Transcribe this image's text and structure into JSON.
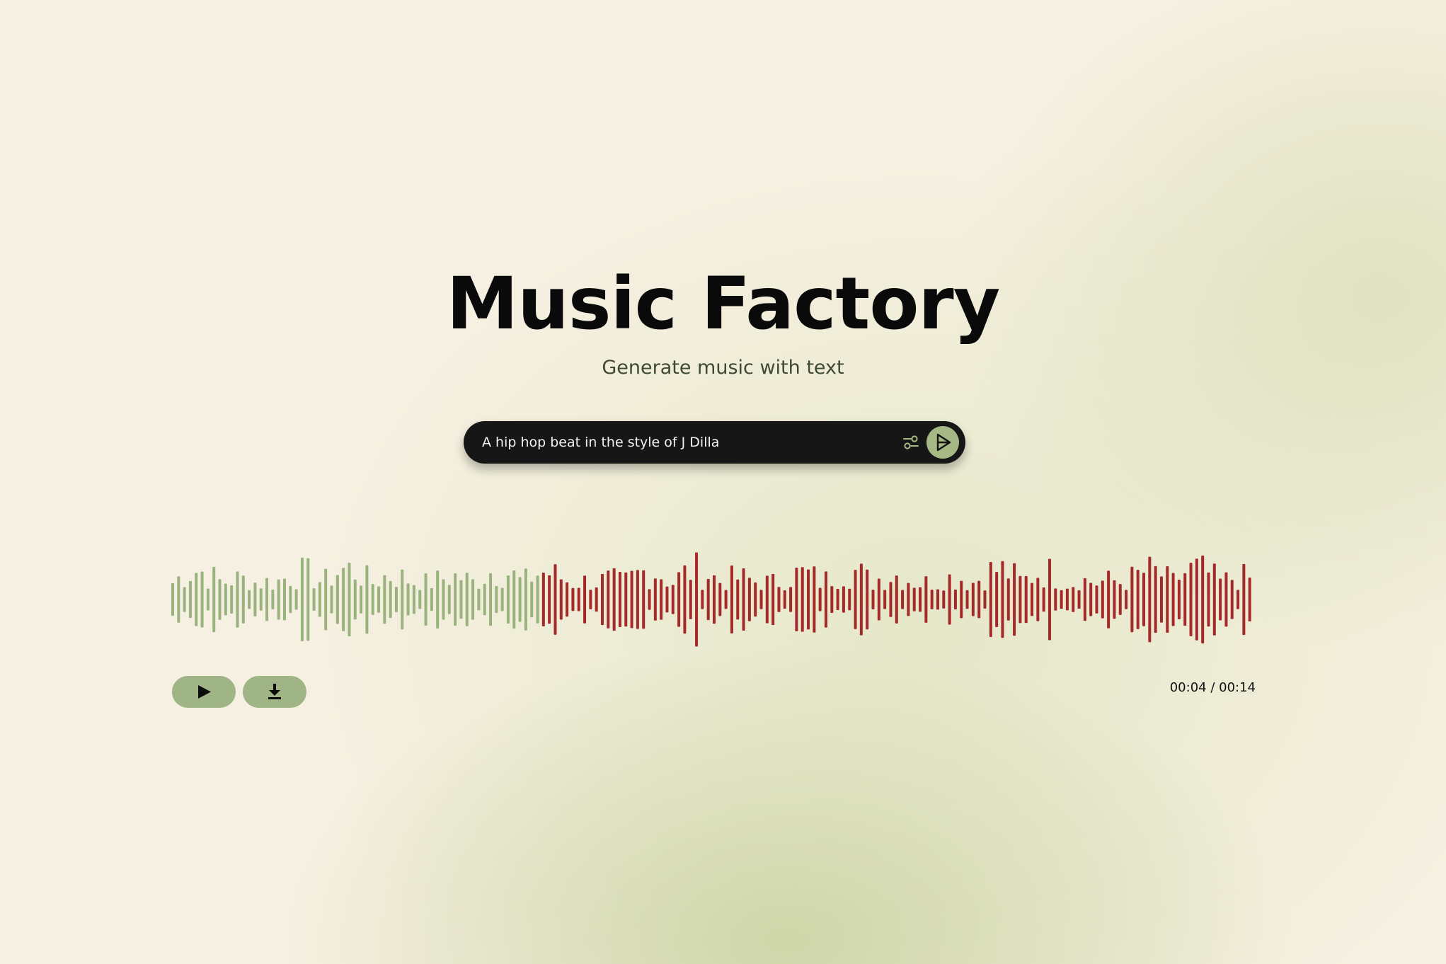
{
  "app": {
    "title": "Music Factory",
    "subtitle": "Generate music with text"
  },
  "prompt": {
    "value": "A hip hop beat in the style of J Dilla",
    "settings_icon": "sliders-icon",
    "send_icon": "send-arrow-icon"
  },
  "player": {
    "current_time": "00:04",
    "total_time": "00:14",
    "time_display": "00:04 / 00:14",
    "progress": 0.34,
    "play_icon": "play-icon",
    "download_icon": "download-icon"
  },
  "waveform": {
    "bar_count": 184,
    "seed": 7,
    "played_color": "#9ab27e",
    "unplayed_color": "#a42a2a"
  },
  "colors": {
    "background": "#f6f0e2",
    "accent": "#a6b985",
    "button": "#9fb585",
    "input_bg": "#161616"
  }
}
